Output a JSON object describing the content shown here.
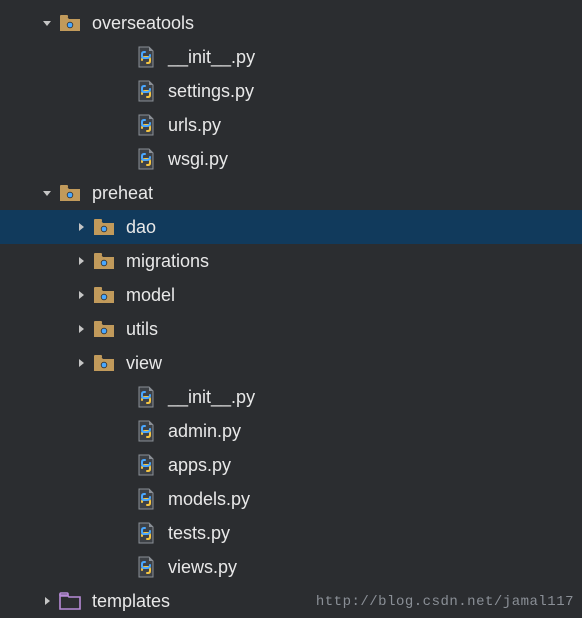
{
  "tree": [
    {
      "depth": 0,
      "arrow": "down",
      "icon": "pkg",
      "label": "overseatools",
      "sel": false
    },
    {
      "depth": 2,
      "arrow": "none",
      "icon": "py",
      "label": "__init__.py",
      "sel": false
    },
    {
      "depth": 2,
      "arrow": "none",
      "icon": "py",
      "label": "settings.py",
      "sel": false
    },
    {
      "depth": 2,
      "arrow": "none",
      "icon": "py",
      "label": "urls.py",
      "sel": false
    },
    {
      "depth": 2,
      "arrow": "none",
      "icon": "py",
      "label": "wsgi.py",
      "sel": false
    },
    {
      "depth": 0,
      "arrow": "down",
      "icon": "pkg",
      "label": "preheat",
      "sel": false
    },
    {
      "depth": 1,
      "arrow": "right",
      "icon": "pkg",
      "label": "dao",
      "sel": true
    },
    {
      "depth": 1,
      "arrow": "right",
      "icon": "pkg",
      "label": "migrations",
      "sel": false
    },
    {
      "depth": 1,
      "arrow": "right",
      "icon": "pkg",
      "label": "model",
      "sel": false
    },
    {
      "depth": 1,
      "arrow": "right",
      "icon": "pkg",
      "label": "utils",
      "sel": false
    },
    {
      "depth": 1,
      "arrow": "right",
      "icon": "pkg",
      "label": "view",
      "sel": false
    },
    {
      "depth": 2,
      "arrow": "none",
      "icon": "py",
      "label": "__init__.py",
      "sel": false
    },
    {
      "depth": 2,
      "arrow": "none",
      "icon": "py",
      "label": "admin.py",
      "sel": false
    },
    {
      "depth": 2,
      "arrow": "none",
      "icon": "py",
      "label": "apps.py",
      "sel": false
    },
    {
      "depth": 2,
      "arrow": "none",
      "icon": "py",
      "label": "models.py",
      "sel": false
    },
    {
      "depth": 2,
      "arrow": "none",
      "icon": "py",
      "label": "tests.py",
      "sel": false
    },
    {
      "depth": 2,
      "arrow": "none",
      "icon": "py",
      "label": "views.py",
      "sel": false
    },
    {
      "depth": 0,
      "arrow": "right",
      "icon": "folder",
      "label": "templates",
      "sel": false
    }
  ],
  "watermark": "http://blog.csdn.net/jamal117"
}
